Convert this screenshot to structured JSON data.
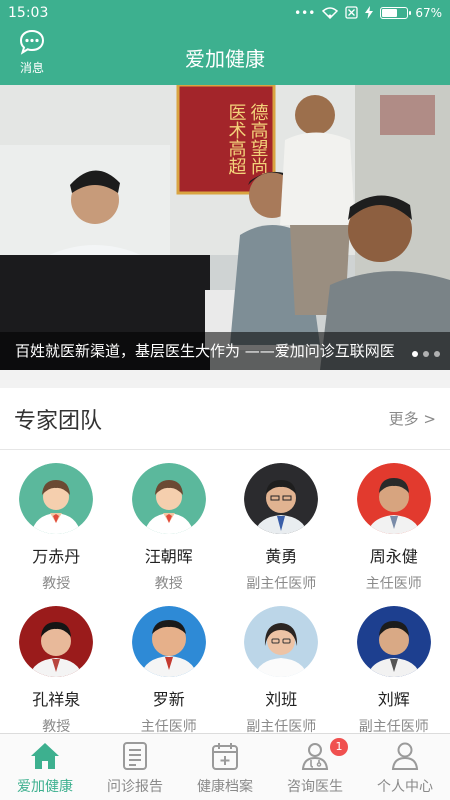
{
  "status_bar": {
    "time": "15:03",
    "battery": "67%",
    "battery_level": 0.67,
    "dots": "•••"
  },
  "header": {
    "title": "爱加健康",
    "message_label": "消息"
  },
  "banner": {
    "caption": "百姓就医新渠道，基层医生大作为 ——爱加问诊互联网医",
    "banner_text": [
      "医术高超",
      "德高望尚"
    ],
    "dots": 3,
    "active_dot": 0
  },
  "experts": {
    "title": "专家团队",
    "more": "更多 >",
    "doctors": [
      {
        "name": "万赤丹",
        "title": "教授",
        "avatar": "placeholder-doctor-icon"
      },
      {
        "name": "汪朝晖",
        "title": "教授",
        "avatar": "placeholder-doctor-icon"
      },
      {
        "name": "黄勇",
        "title": "副主任医师",
        "avatar": "doctor-photo"
      },
      {
        "name": "周永健",
        "title": "主任医师",
        "avatar": "doctor-photo"
      },
      {
        "name": "孔祥泉",
        "title": "教授",
        "avatar": "doctor-photo"
      },
      {
        "name": "罗新",
        "title": "主任医师",
        "avatar": "doctor-photo"
      },
      {
        "name": "刘班",
        "title": "副主任医师",
        "avatar": "doctor-photo"
      },
      {
        "name": "刘辉",
        "title": "副主任医师",
        "avatar": "doctor-photo"
      }
    ]
  },
  "bottom_nav": {
    "items": [
      {
        "label": "爱加健康",
        "icon": "home-icon",
        "active": true
      },
      {
        "label": "问诊报告",
        "icon": "report-icon"
      },
      {
        "label": "健康档案",
        "icon": "health-record-icon"
      },
      {
        "label": "咨询医生",
        "icon": "doctor-consult-icon",
        "badge": "1"
      },
      {
        "label": "个人中心",
        "icon": "user-icon"
      }
    ]
  },
  "colors": {
    "brand": "#3db08f",
    "badge": "#f0504f",
    "muted": "#8a8a8a"
  }
}
